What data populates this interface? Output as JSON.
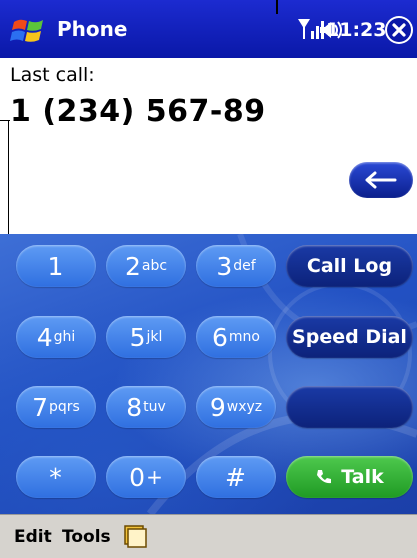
{
  "titlebar": {
    "title": "Phone",
    "time": "11:23",
    "icons": [
      "windows-start-icon",
      "signal-icon",
      "speaker-icon",
      "close-icon"
    ]
  },
  "call_info": {
    "label": "Last call:",
    "number": "1 (234) 567-89"
  },
  "keypad": {
    "keys": [
      {
        "digit": "1",
        "letters": ""
      },
      {
        "digit": "2",
        "letters": "abc"
      },
      {
        "digit": "3",
        "letters": "def"
      },
      {
        "digit": "4",
        "letters": "ghi"
      },
      {
        "digit": "5",
        "letters": "jkl"
      },
      {
        "digit": "6",
        "letters": "mno"
      },
      {
        "digit": "7",
        "letters": "pqrs"
      },
      {
        "digit": "8",
        "letters": "tuv"
      },
      {
        "digit": "9",
        "letters": "wxyz"
      },
      {
        "digit": "*",
        "letters": ""
      },
      {
        "digit": "0",
        "letters": "+"
      },
      {
        "digit": "#",
        "letters": ""
      }
    ],
    "call_log": "Call Log",
    "speed_dial": "Speed Dial",
    "talk": "Talk"
  },
  "menubar": {
    "edit": "Edit",
    "tools": "Tools"
  },
  "colors": {
    "titlebar": "#1c2bd0",
    "key": "#3f7fe8",
    "key_dark": "#132e90",
    "talk": "#2fb034",
    "menubar": "#d6d3ce"
  }
}
